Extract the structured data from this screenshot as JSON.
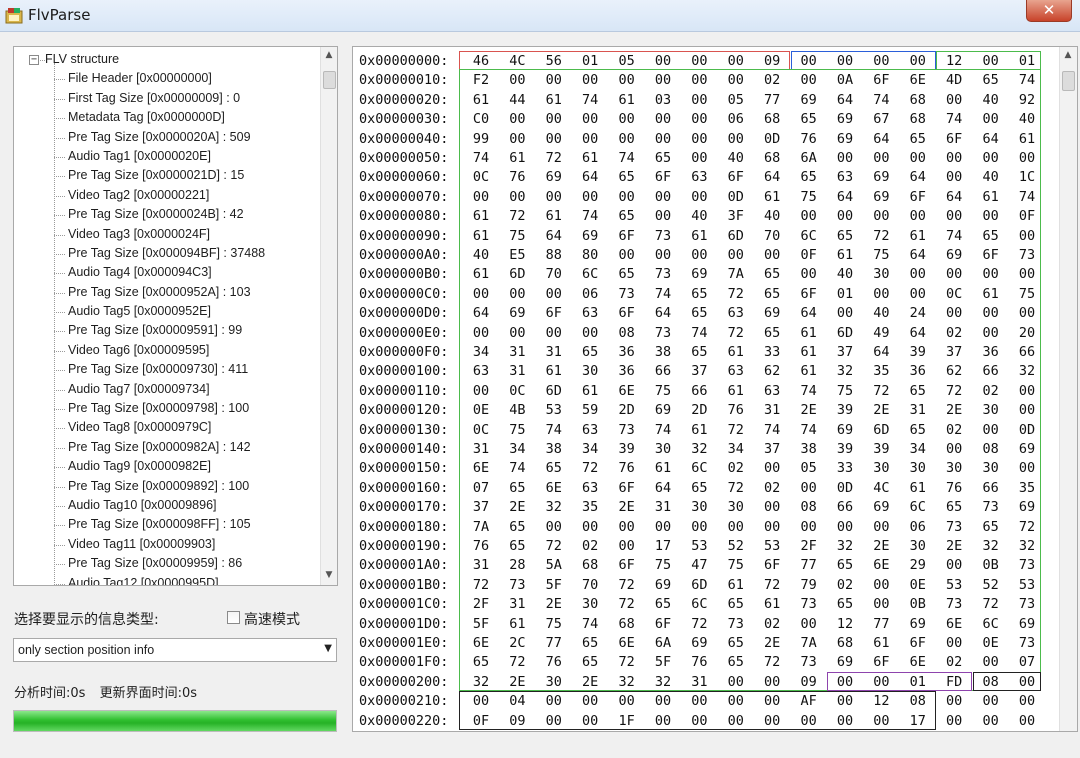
{
  "window": {
    "title": "FlvParse",
    "close_label": "✕"
  },
  "tree": {
    "root": "FLV structure",
    "items": [
      "File Header [0x00000000]",
      "First Tag Size [0x00000009] : 0",
      "Metadata Tag [0x0000000D]",
      "Pre Tag Size [0x0000020A] : 509",
      "Audio Tag1 [0x0000020E]",
      "Pre Tag Size [0x0000021D] : 15",
      "Video Tag2 [0x00000221]",
      "Pre Tag Size [0x0000024B] : 42",
      "Video Tag3 [0x0000024F]",
      "Pre Tag Size [0x000094BF] : 37488",
      "Audio Tag4 [0x000094C3]",
      "Pre Tag Size [0x0000952A] : 103",
      "Audio Tag5 [0x0000952E]",
      "Pre Tag Size [0x00009591] : 99",
      "Video Tag6 [0x00009595]",
      "Pre Tag Size [0x00009730] : 411",
      "Audio Tag7 [0x00009734]",
      "Pre Tag Size [0x00009798] : 100",
      "Video Tag8 [0x0000979C]",
      "Pre Tag Size [0x0000982A] : 142",
      "Audio Tag9 [0x0000982E]",
      "Pre Tag Size [0x00009892] : 100",
      "Audio Tag10 [0x00009896]",
      "Pre Tag Size [0x000098FF] : 105",
      "Video Tag11 [0x00009903]",
      "Pre Tag Size [0x00009959] : 86",
      "Audio Tag12 [0x0000995D]"
    ]
  },
  "controls": {
    "type_label": "选择要显示的信息类型:",
    "fast_mode_label": "高速模式",
    "fast_mode_checked": false,
    "type_selected": "only section position info",
    "analysis_time": "分析时间:0s",
    "refresh_time": "更新界面时间:0s",
    "progress": 1.0
  },
  "hex": {
    "rows": [
      {
        "addr": "0x00000000:",
        "bytes": [
          "46",
          "4C",
          "56",
          "01",
          "05",
          "00",
          "00",
          "00",
          "09",
          "00",
          "00",
          "00",
          "00",
          "12",
          "00",
          "01"
        ]
      },
      {
        "addr": "0x00000010:",
        "bytes": [
          "F2",
          "00",
          "00",
          "00",
          "00",
          "00",
          "00",
          "00",
          "02",
          "00",
          "0A",
          "6F",
          "6E",
          "4D",
          "65",
          "74"
        ]
      },
      {
        "addr": "0x00000020:",
        "bytes": [
          "61",
          "44",
          "61",
          "74",
          "61",
          "03",
          "00",
          "05",
          "77",
          "69",
          "64",
          "74",
          "68",
          "00",
          "40",
          "92"
        ]
      },
      {
        "addr": "0x00000030:",
        "bytes": [
          "C0",
          "00",
          "00",
          "00",
          "00",
          "00",
          "00",
          "06",
          "68",
          "65",
          "69",
          "67",
          "68",
          "74",
          "00",
          "40"
        ]
      },
      {
        "addr": "0x00000040:",
        "bytes": [
          "99",
          "00",
          "00",
          "00",
          "00",
          "00",
          "00",
          "00",
          "0D",
          "76",
          "69",
          "64",
          "65",
          "6F",
          "64",
          "61"
        ]
      },
      {
        "addr": "0x00000050:",
        "bytes": [
          "74",
          "61",
          "72",
          "61",
          "74",
          "65",
          "00",
          "40",
          "68",
          "6A",
          "00",
          "00",
          "00",
          "00",
          "00",
          "00"
        ]
      },
      {
        "addr": "0x00000060:",
        "bytes": [
          "0C",
          "76",
          "69",
          "64",
          "65",
          "6F",
          "63",
          "6F",
          "64",
          "65",
          "63",
          "69",
          "64",
          "00",
          "40",
          "1C"
        ]
      },
      {
        "addr": "0x00000070:",
        "bytes": [
          "00",
          "00",
          "00",
          "00",
          "00",
          "00",
          "00",
          "0D",
          "61",
          "75",
          "64",
          "69",
          "6F",
          "64",
          "61",
          "74"
        ]
      },
      {
        "addr": "0x00000080:",
        "bytes": [
          "61",
          "72",
          "61",
          "74",
          "65",
          "00",
          "40",
          "3F",
          "40",
          "00",
          "00",
          "00",
          "00",
          "00",
          "00",
          "0F"
        ]
      },
      {
        "addr": "0x00000090:",
        "bytes": [
          "61",
          "75",
          "64",
          "69",
          "6F",
          "73",
          "61",
          "6D",
          "70",
          "6C",
          "65",
          "72",
          "61",
          "74",
          "65",
          "00"
        ]
      },
      {
        "addr": "0x000000A0:",
        "bytes": [
          "40",
          "E5",
          "88",
          "80",
          "00",
          "00",
          "00",
          "00",
          "00",
          "0F",
          "61",
          "75",
          "64",
          "69",
          "6F",
          "73"
        ]
      },
      {
        "addr": "0x000000B0:",
        "bytes": [
          "61",
          "6D",
          "70",
          "6C",
          "65",
          "73",
          "69",
          "7A",
          "65",
          "00",
          "40",
          "30",
          "00",
          "00",
          "00",
          "00"
        ]
      },
      {
        "addr": "0x000000C0:",
        "bytes": [
          "00",
          "00",
          "00",
          "06",
          "73",
          "74",
          "65",
          "72",
          "65",
          "6F",
          "01",
          "00",
          "00",
          "0C",
          "61",
          "75"
        ]
      },
      {
        "addr": "0x000000D0:",
        "bytes": [
          "64",
          "69",
          "6F",
          "63",
          "6F",
          "64",
          "65",
          "63",
          "69",
          "64",
          "00",
          "40",
          "24",
          "00",
          "00",
          "00"
        ]
      },
      {
        "addr": "0x000000E0:",
        "bytes": [
          "00",
          "00",
          "00",
          "00",
          "08",
          "73",
          "74",
          "72",
          "65",
          "61",
          "6D",
          "49",
          "64",
          "02",
          "00",
          "20"
        ]
      },
      {
        "addr": "0x000000F0:",
        "bytes": [
          "34",
          "31",
          "31",
          "65",
          "36",
          "38",
          "65",
          "61",
          "33",
          "61",
          "37",
          "64",
          "39",
          "37",
          "36",
          "66"
        ]
      },
      {
        "addr": "0x00000100:",
        "bytes": [
          "63",
          "31",
          "61",
          "30",
          "36",
          "66",
          "37",
          "63",
          "62",
          "61",
          "32",
          "35",
          "36",
          "62",
          "66",
          "32"
        ]
      },
      {
        "addr": "0x00000110:",
        "bytes": [
          "00",
          "0C",
          "6D",
          "61",
          "6E",
          "75",
          "66",
          "61",
          "63",
          "74",
          "75",
          "72",
          "65",
          "72",
          "02",
          "00"
        ]
      },
      {
        "addr": "0x00000120:",
        "bytes": [
          "0E",
          "4B",
          "53",
          "59",
          "2D",
          "69",
          "2D",
          "76",
          "31",
          "2E",
          "39",
          "2E",
          "31",
          "2E",
          "30",
          "00"
        ]
      },
      {
        "addr": "0x00000130:",
        "bytes": [
          "0C",
          "75",
          "74",
          "63",
          "73",
          "74",
          "61",
          "72",
          "74",
          "74",
          "69",
          "6D",
          "65",
          "02",
          "00",
          "0D"
        ]
      },
      {
        "addr": "0x00000140:",
        "bytes": [
          "31",
          "34",
          "38",
          "34",
          "39",
          "30",
          "32",
          "34",
          "37",
          "38",
          "39",
          "39",
          "34",
          "00",
          "08",
          "69"
        ]
      },
      {
        "addr": "0x00000150:",
        "bytes": [
          "6E",
          "74",
          "65",
          "72",
          "76",
          "61",
          "6C",
          "02",
          "00",
          "05",
          "33",
          "30",
          "30",
          "30",
          "30",
          "00"
        ]
      },
      {
        "addr": "0x00000160:",
        "bytes": [
          "07",
          "65",
          "6E",
          "63",
          "6F",
          "64",
          "65",
          "72",
          "02",
          "00",
          "0D",
          "4C",
          "61",
          "76",
          "66",
          "35"
        ]
      },
      {
        "addr": "0x00000170:",
        "bytes": [
          "37",
          "2E",
          "32",
          "35",
          "2E",
          "31",
          "30",
          "30",
          "00",
          "08",
          "66",
          "69",
          "6C",
          "65",
          "73",
          "69"
        ]
      },
      {
        "addr": "0x00000180:",
        "bytes": [
          "7A",
          "65",
          "00",
          "00",
          "00",
          "00",
          "00",
          "00",
          "00",
          "00",
          "00",
          "00",
          "06",
          "73",
          "65",
          "72"
        ]
      },
      {
        "addr": "0x00000190:",
        "bytes": [
          "76",
          "65",
          "72",
          "02",
          "00",
          "17",
          "53",
          "52",
          "53",
          "2F",
          "32",
          "2E",
          "30",
          "2E",
          "32",
          "32"
        ]
      },
      {
        "addr": "0x000001A0:",
        "bytes": [
          "31",
          "28",
          "5A",
          "68",
          "6F",
          "75",
          "47",
          "75",
          "6F",
          "77",
          "65",
          "6E",
          "29",
          "00",
          "0B",
          "73"
        ]
      },
      {
        "addr": "0x000001B0:",
        "bytes": [
          "72",
          "73",
          "5F",
          "70",
          "72",
          "69",
          "6D",
          "61",
          "72",
          "79",
          "02",
          "00",
          "0E",
          "53",
          "52",
          "53"
        ]
      },
      {
        "addr": "0x000001C0:",
        "bytes": [
          "2F",
          "31",
          "2E",
          "30",
          "72",
          "65",
          "6C",
          "65",
          "61",
          "73",
          "65",
          "00",
          "0B",
          "73",
          "72",
          "73"
        ]
      },
      {
        "addr": "0x000001D0:",
        "bytes": [
          "5F",
          "61",
          "75",
          "74",
          "68",
          "6F",
          "72",
          "73",
          "02",
          "00",
          "12",
          "77",
          "69",
          "6E",
          "6C",
          "69"
        ]
      },
      {
        "addr": "0x000001E0:",
        "bytes": [
          "6E",
          "2C",
          "77",
          "65",
          "6E",
          "6A",
          "69",
          "65",
          "2E",
          "7A",
          "68",
          "61",
          "6F",
          "00",
          "0E",
          "73"
        ]
      },
      {
        "addr": "0x000001F0:",
        "bytes": [
          "65",
          "72",
          "76",
          "65",
          "72",
          "5F",
          "76",
          "65",
          "72",
          "73",
          "69",
          "6F",
          "6E",
          "02",
          "00",
          "07"
        ]
      },
      {
        "addr": "0x00000200:",
        "bytes": [
          "32",
          "2E",
          "30",
          "2E",
          "32",
          "32",
          "31",
          "00",
          "00",
          "09",
          "00",
          "00",
          "01",
          "FD",
          "08",
          "00"
        ]
      },
      {
        "addr": "0x00000210:",
        "bytes": [
          "00",
          "04",
          "00",
          "00",
          "00",
          "00",
          "00",
          "00",
          "00",
          "AF",
          "00",
          "12",
          "08",
          "00",
          "00",
          "00"
        ]
      },
      {
        "addr": "0x00000220:",
        "bytes": [
          "0F",
          "09",
          "00",
          "00",
          "1F",
          "00",
          "00",
          "00",
          "00",
          "00",
          "00",
          "00",
          "17",
          "00",
          "00",
          "00"
        ]
      }
    ],
    "highlight_colors": {
      "header": "#d9534f",
      "first_tag_size": "#2b5fd9",
      "metadata": "#4cbb4c",
      "pre_tag_size": "#8e44ad",
      "next_tag": "#222222"
    }
  }
}
